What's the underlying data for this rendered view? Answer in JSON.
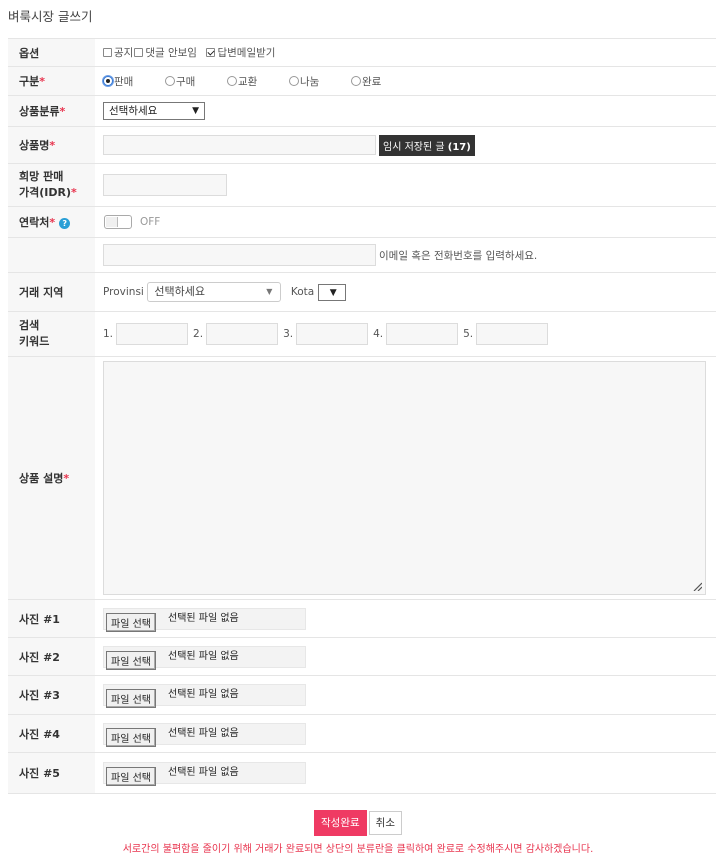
{
  "page": {
    "title": "벼룩시장 글쓰기"
  },
  "options": {
    "label": "옵션",
    "notice": "공지",
    "hide_comments": "댓글 안보임",
    "reply_email": "답변메일받기"
  },
  "category": {
    "label": "구분",
    "choices": [
      "판매",
      "구매",
      "교환",
      "나눔",
      "완료"
    ],
    "selected_index": 0
  },
  "product_class": {
    "label": "상품분류",
    "selected": "선택하세요"
  },
  "product_name": {
    "label": "상품명",
    "saved_label": "임시 저장된 글",
    "saved_count": "(17)"
  },
  "price": {
    "label_line1": "희망 판매",
    "label_line2": "가격(IDR)"
  },
  "contact": {
    "label": "연락처",
    "toggle_state": "OFF",
    "hint": "이메일 혹은 전화번호를 입력하세요."
  },
  "region": {
    "label": "거래 지역",
    "provinsi_label": "Provinsi",
    "provinsi_selected": "선택하세요",
    "kota_label": "Kota"
  },
  "keywords": {
    "label_line1": "검색",
    "label_line2": "키워드",
    "numbers": [
      "1.",
      "2.",
      "3.",
      "4.",
      "5."
    ]
  },
  "description": {
    "label": "상품 설명"
  },
  "photos": {
    "button_label": "파일 선택",
    "no_file_text": "선택된 파일 없음",
    "items": [
      {
        "label": "사진 #1"
      },
      {
        "label": "사진 #2"
      },
      {
        "label": "사진 #3"
      },
      {
        "label": "사진 #4"
      },
      {
        "label": "사진 #5"
      }
    ]
  },
  "actions": {
    "submit": "작성완료",
    "cancel": "취소"
  },
  "footer_notice": "서로간의 불편함을 줄이기 위해 거래가 완료되면 상단의 분류란을 클릭하여 완료로 수정해주시면 감사하겠습니다.",
  "colors": {
    "accent": "#ef3a63",
    "required": "#e8344e",
    "help": "#2a9fd6"
  },
  "required_mark": "*",
  "help_mark": "?"
}
